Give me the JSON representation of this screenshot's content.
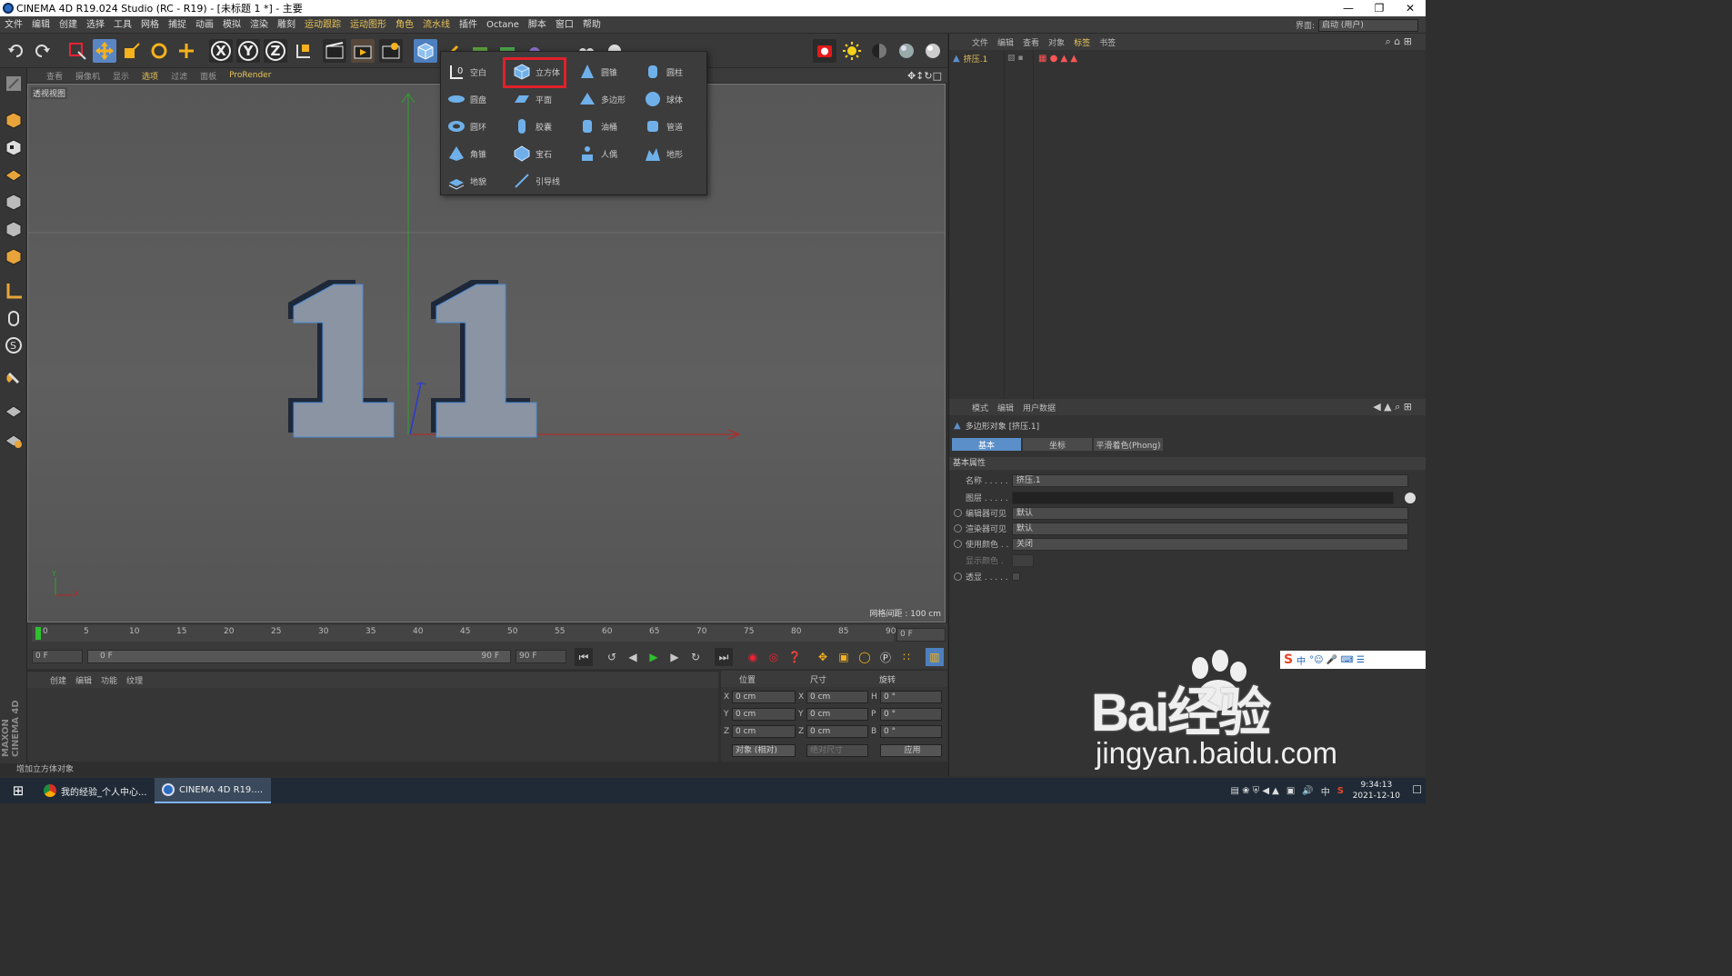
{
  "window": {
    "title": "CINEMA 4D R19.024 Studio (RC - R19) - [未标题 1 *] - 主要"
  },
  "menu": [
    "文件",
    "编辑",
    "创建",
    "选择",
    "工具",
    "网格",
    "捕捉",
    "动画",
    "模拟",
    "渲染",
    "雕刻",
    "运动跟踪",
    "运动图形",
    "角色",
    "流水线",
    "插件",
    "Octane",
    "脚本",
    "窗口",
    "帮助"
  ],
  "menu_highlight": [
    "运动跟踪",
    "运动图形",
    "角色",
    "流水线"
  ],
  "interface": {
    "label": "界面:",
    "value": "启动 (用户)"
  },
  "toolbar": {
    "x": "X",
    "y": "Y",
    "z": "Z"
  },
  "viewport_menu": [
    "查看",
    "摄像机",
    "显示",
    "选项",
    "过滤",
    "面板",
    "ProRender"
  ],
  "viewport": {
    "label": "透视视图",
    "grid_spacing": "网格间距 : 100 cm",
    "model_text": "11",
    "axis_y": "Y",
    "axis_x": "X"
  },
  "popup": {
    "items": [
      {
        "label": "空白",
        "icon": "null-icon"
      },
      {
        "label": "立方体",
        "icon": "cube-icon"
      },
      {
        "label": "圆锥",
        "icon": "cone-icon"
      },
      {
        "label": "圆柱",
        "icon": "cylinder-icon"
      },
      {
        "label": "圆盘",
        "icon": "disc-icon"
      },
      {
        "label": "平面",
        "icon": "plane-icon"
      },
      {
        "label": "多边形",
        "icon": "polygon-icon"
      },
      {
        "label": "球体",
        "icon": "sphere-icon"
      },
      {
        "label": "圆环",
        "icon": "torus-icon"
      },
      {
        "label": "胶囊",
        "icon": "capsule-icon"
      },
      {
        "label": "油桶",
        "icon": "oil-tank-icon"
      },
      {
        "label": "管道",
        "icon": "tube-icon"
      },
      {
        "label": "角锥",
        "icon": "pyramid-icon"
      },
      {
        "label": "宝石",
        "icon": "gem-icon"
      },
      {
        "label": "人偶",
        "icon": "figure-icon"
      },
      {
        "label": "地形",
        "icon": "landscape-icon"
      },
      {
        "label": "地貌",
        "icon": "relief-icon"
      },
      {
        "label": "引导线",
        "icon": "guide-icon"
      }
    ]
  },
  "object_manager": {
    "menu": [
      "文件",
      "编辑",
      "查看",
      "对象",
      "标签",
      "书签"
    ],
    "highlight": "标签",
    "objects": [
      {
        "name": "挤压.1"
      }
    ]
  },
  "attributes": {
    "menu": [
      "模式",
      "编辑",
      "用户数据"
    ],
    "object_title": "多边形对象 [挤压.1]",
    "tabs": [
      "基本",
      "坐标",
      "平滑着色(Phong)"
    ],
    "section": "基本属性",
    "rows": [
      {
        "label": "名称 . . . . .",
        "value": "挤压.1"
      },
      {
        "label": "图层 . . . . .",
        "value": ""
      },
      {
        "label": "编辑器可见",
        "value": "默认"
      },
      {
        "label": "渲染器可见",
        "value": "默认"
      },
      {
        "label": "使用颜色 . .",
        "value": "关闭"
      },
      {
        "label": "显示颜色 .",
        "value": ""
      },
      {
        "label": "透显 . . . . .",
        "value": ""
      }
    ]
  },
  "timeline": {
    "ticks": [
      "0",
      "5",
      "10",
      "15",
      "20",
      "25",
      "30",
      "35",
      "40",
      "45",
      "50",
      "55",
      "60",
      "65",
      "70",
      "75",
      "80",
      "85",
      "90"
    ],
    "current_frame": "0 F",
    "start": "0 F",
    "range_start": "0 F",
    "range_end": "90 F",
    "end": "90 F"
  },
  "material_menu": [
    "创建",
    "编辑",
    "功能",
    "纹理"
  ],
  "coords": {
    "headers": [
      "位置",
      "尺寸",
      "旋转"
    ],
    "rows": [
      {
        "axis": "X",
        "pos": "0 cm",
        "size": "0 cm",
        "raxis": "H",
        "rot": "0 °"
      },
      {
        "axis": "Y",
        "pos": "0 cm",
        "size": "0 cm",
        "raxis": "P",
        "rot": "0 °"
      },
      {
        "axis": "Z",
        "pos": "0 cm",
        "size": "0 cm",
        "raxis": "B",
        "rot": "0 °"
      }
    ],
    "mode": "对象 (相对)",
    "size_mode": "绝对尺寸",
    "apply": "应用"
  },
  "status": "增加立方体对象",
  "taskbar": {
    "apps": [
      "我的经验_个人中心...",
      "CINEMA 4D R19...."
    ],
    "time": "9:34:13",
    "date": "2021-12-10",
    "tray_lang": "中",
    "ime_label": "中"
  },
  "watermark": {
    "big": "Bai经验",
    "small": "jingyan.baidu.com"
  },
  "colors": {
    "accent_orange": "#e8c45a",
    "highlight_red": "#e0202a",
    "tab_blue": "#5b8fc9"
  }
}
